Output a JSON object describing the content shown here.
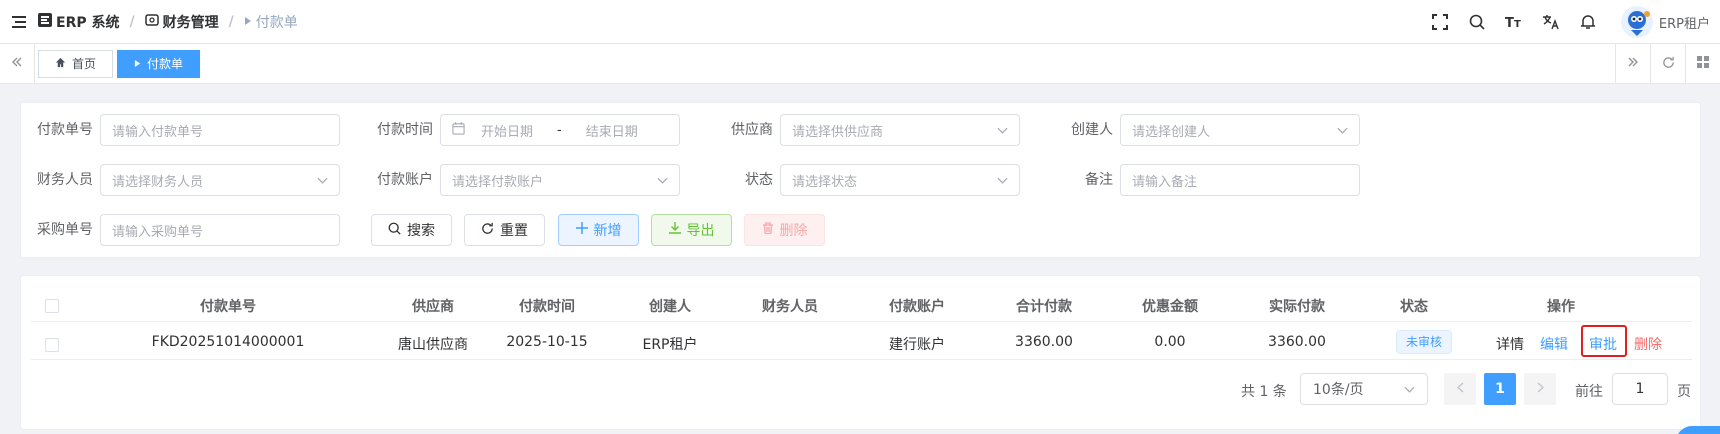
{
  "navbar": {
    "breadcrumb": [
      {
        "label": "ERP 系统",
        "icon": "app-logo-icon"
      },
      {
        "label": "财务管理",
        "icon": "finance-icon"
      },
      {
        "label": "付款单",
        "icon": "caret-right-icon"
      }
    ],
    "user_name": "ERP租户",
    "icons": [
      "fullscreen-icon",
      "search-icon",
      "font-size-icon",
      "translate-icon",
      "bell-icon"
    ]
  },
  "tags": {
    "items": [
      {
        "label": "首页",
        "icon": "home-icon",
        "active": false
      },
      {
        "label": "付款单",
        "icon": "caret-right-icon",
        "active": true
      }
    ]
  },
  "search": {
    "fields": [
      {
        "label": "付款单号",
        "placeholder": "请输入付款单号",
        "type": "input"
      },
      {
        "label": "付款时间",
        "start_placeholder": "开始日期",
        "end_placeholder": "结束日期",
        "separator": "-",
        "type": "daterange"
      },
      {
        "label": "供应商",
        "placeholder": "请选择供供应商",
        "type": "select"
      },
      {
        "label": "创建人",
        "placeholder": "请选择创建人",
        "type": "select"
      },
      {
        "label": "财务人员",
        "placeholder": "请选择财务人员",
        "type": "select"
      },
      {
        "label": "付款账户",
        "placeholder": "请选择付款账户",
        "type": "select"
      },
      {
        "label": "状态",
        "placeholder": "请选择状态",
        "type": "select"
      },
      {
        "label": "备注",
        "placeholder": "请输入备注",
        "type": "input"
      },
      {
        "label": "采购单号",
        "placeholder": "请输入采购单号",
        "type": "input"
      }
    ],
    "buttons": {
      "search": "搜索",
      "reset": "重置",
      "add": "新增",
      "export": "导出",
      "delete": "删除"
    }
  },
  "table": {
    "columns": [
      "付款单号",
      "供应商",
      "付款时间",
      "创建人",
      "财务人员",
      "付款账户",
      "合计付款",
      "优惠金额",
      "实际付款",
      "状态",
      "操作"
    ],
    "rows": [
      {
        "no": "FKD20251014000001",
        "supplier": "唐山供应商",
        "time": "2025-10-15",
        "creator": "ERP租户",
        "finance": "",
        "account": "建行账户",
        "total": "3360.00",
        "discount": "0.00",
        "actual": "3360.00",
        "status": "未审核",
        "ops": {
          "detail": "详情",
          "edit": "编辑",
          "approve": "审批",
          "delete": "删除"
        }
      }
    ]
  },
  "pagination": {
    "total_text": "共 1 条",
    "page_size": "10条/页",
    "current_page": "1",
    "goto_label": "前往",
    "goto_value": "1",
    "page_suffix": "页"
  },
  "colors": {
    "primary": "#409eff",
    "danger": "#f56c6c",
    "success": "#67c23a",
    "highlight": "#e02020"
  }
}
